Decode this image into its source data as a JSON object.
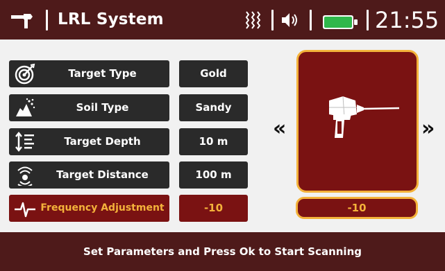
{
  "header": {
    "title": "LRL System",
    "time": "21:55",
    "icons": {
      "logo": "detector-logo-icon",
      "signal": "signal-icon",
      "speaker": "speaker-icon",
      "battery": "battery-icon"
    },
    "battery_color": "#2fb84b"
  },
  "parameters": [
    {
      "icon": "target-icon",
      "label": "Target Type",
      "value": "Gold"
    },
    {
      "icon": "soil-icon",
      "label": "Soil Type",
      "value": "Sandy"
    },
    {
      "icon": "depth-icon",
      "label": "Target Depth",
      "value": "10 m"
    },
    {
      "icon": "distance-icon",
      "label": "Target Distance",
      "value": "100 m"
    },
    {
      "icon": "frequency-icon",
      "label": "Frequency Adjustment",
      "value": "-10",
      "active": true
    }
  ],
  "device": {
    "icon": "detector-device-icon",
    "value": "-10",
    "prev_icon": "chevron-left-icon",
    "next_icon": "chevron-right-icon",
    "prev_glyph": "«",
    "next_glyph": "»"
  },
  "footer": {
    "message": "Set Parameters and Press Ok to Start Scanning"
  },
  "colors": {
    "header_bg": "#4e1a1a",
    "panel_bg": "#2a2a2a",
    "accent_bg": "#7a1212",
    "accent_text": "#f4b23a"
  }
}
